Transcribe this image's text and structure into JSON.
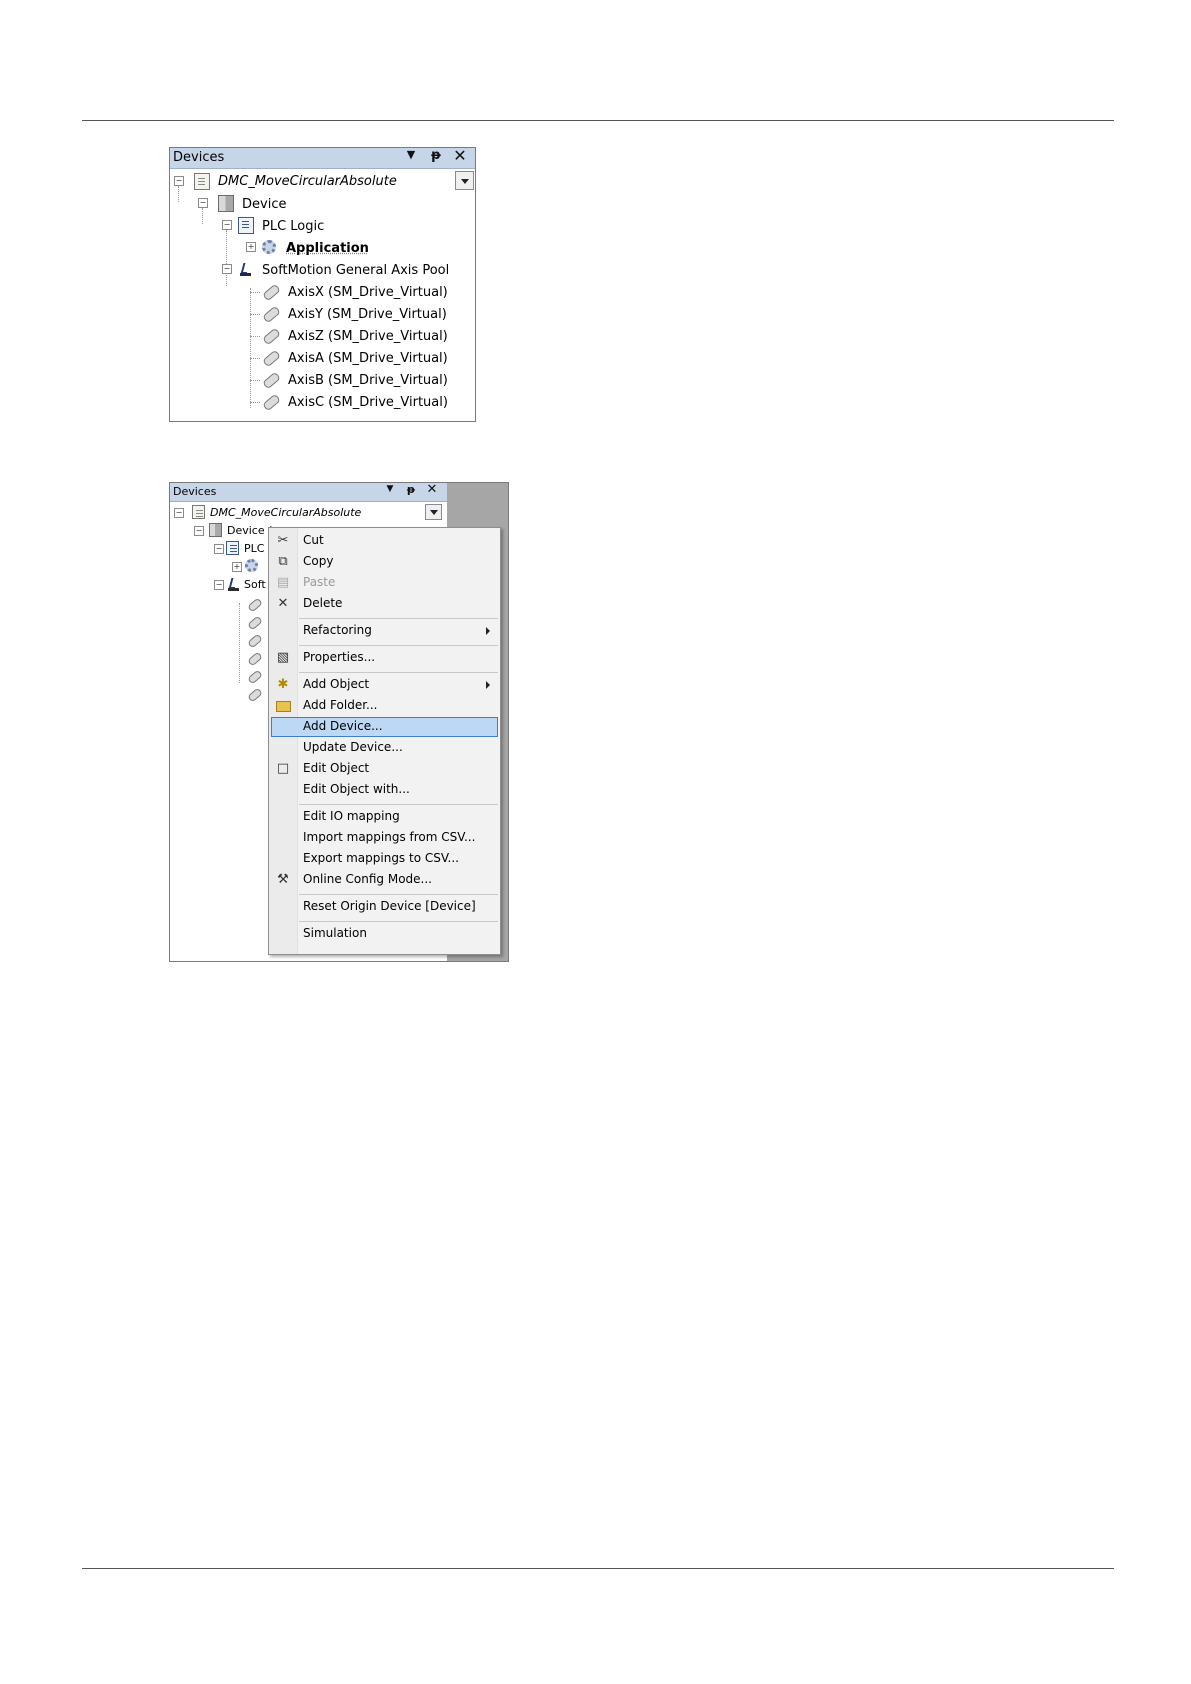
{
  "panel1": {
    "title": "Devices",
    "tree": {
      "project": "DMC_MoveCircularAbsolute",
      "device": "Device",
      "plc_logic": "PLC Logic",
      "application": "Application",
      "axis_pool": "SoftMotion General Axis Pool",
      "axes": [
        "AxisX (SM_Drive_Virtual)",
        "AxisY (SM_Drive_Virtual)",
        "AxisZ (SM_Drive_Virtual)",
        "AxisA (SM_Drive_Virtual)",
        "AxisB (SM_Drive_Virtual)",
        "AxisC (SM_Drive_Virtual)"
      ]
    }
  },
  "panel2": {
    "title": "Devices",
    "tree": {
      "project": "DMC_MoveCircularAbsolute",
      "device": "Device (",
      "plc_partial": "PLC",
      "soft_partial": "Soft"
    },
    "context_menu": {
      "items": [
        {
          "label": "Cut",
          "icon": "scissors-icon"
        },
        {
          "label": "Copy",
          "icon": "copy-icon"
        },
        {
          "label": "Paste",
          "icon": "paste-icon",
          "disabled": true
        },
        {
          "label": "Delete",
          "icon": "delete-icon"
        },
        {
          "label": "Refactoring",
          "submenu": true
        },
        {
          "label": "Properties...",
          "icon": "properties-icon"
        },
        {
          "label": "Add Object",
          "icon": "add-object-icon",
          "submenu": true
        },
        {
          "label": "Add Folder...",
          "icon": "folder-icon"
        },
        {
          "label": "Add Device...",
          "highlighted": true
        },
        {
          "label": "Update Device..."
        },
        {
          "label": "Edit Object",
          "icon": "edit-object-icon"
        },
        {
          "label": "Edit Object with..."
        },
        {
          "label": "Edit IO mapping"
        },
        {
          "label": "Import mappings from CSV..."
        },
        {
          "label": "Export mappings to CSV..."
        },
        {
          "label": "Online Config Mode...",
          "icon": "tools-icon"
        },
        {
          "label": "Reset Origin Device [Device]"
        },
        {
          "label": "Simulation"
        }
      ]
    }
  }
}
